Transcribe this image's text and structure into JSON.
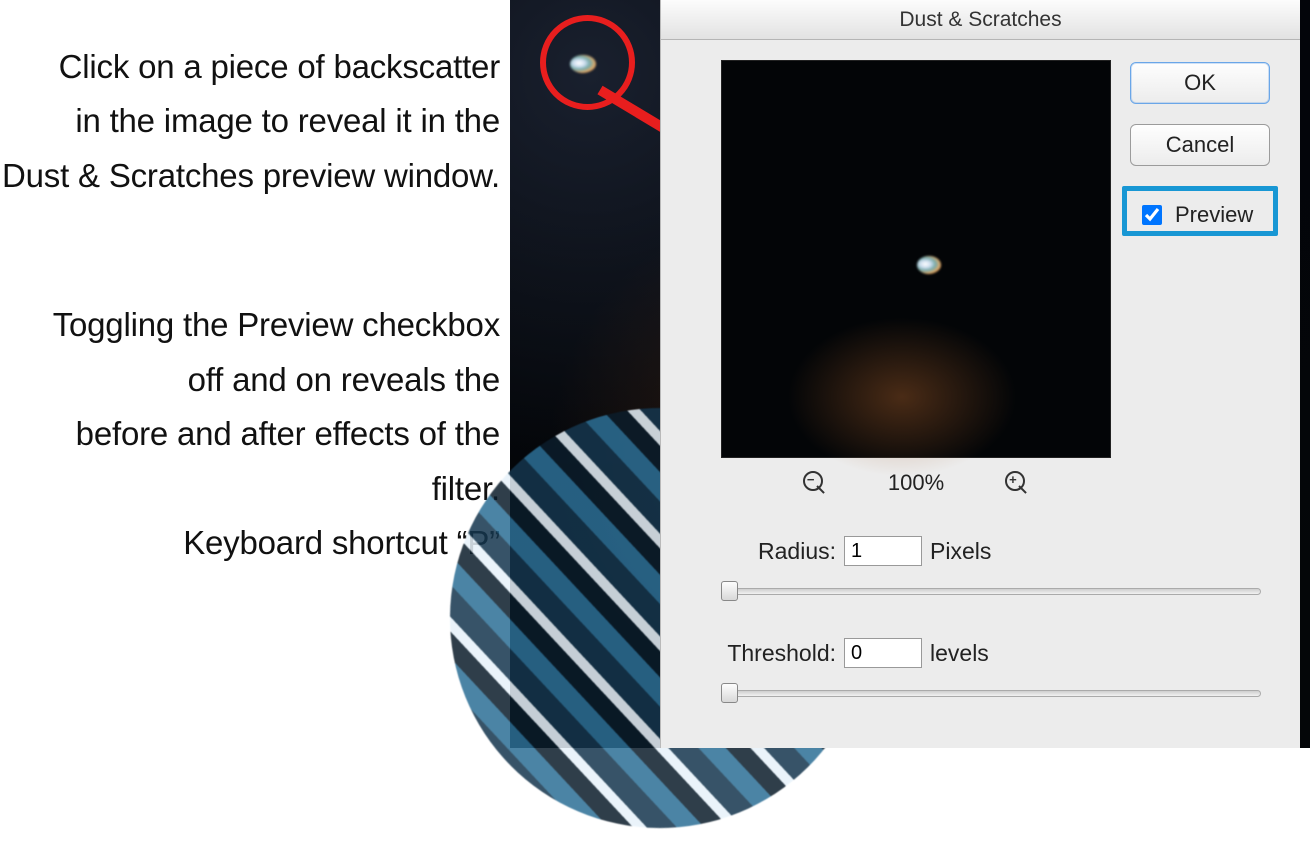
{
  "instructions": {
    "block1_line1": "Click on a piece of backscatter",
    "block1_line2": "in the image to reveal it in the",
    "block1_line3": "Dust & Scratches preview window.",
    "block2_line1": "Toggling the Preview checkbox",
    "block2_line2": "off and on reveals the",
    "block2_line3": "before and after effects of the filter.",
    "block2_line4": "Keyboard shortcut “P”"
  },
  "dialog": {
    "title": "Dust & Scratches",
    "ok_label": "OK",
    "cancel_label": "Cancel",
    "preview_label": "Preview",
    "preview_checked": true,
    "zoom_level": "100%",
    "radius_label": "Radius:",
    "radius_value": "1",
    "radius_unit": "Pixels",
    "threshold_label": "Threshold:",
    "threshold_value": "0",
    "threshold_unit": "levels"
  },
  "icons": {
    "zoom_out_sign": "−",
    "zoom_in_sign": "+"
  }
}
